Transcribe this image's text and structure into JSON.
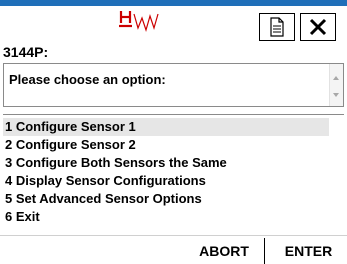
{
  "header": {
    "top_clip_text": "",
    "device_title": "3144P:"
  },
  "icons": {
    "logo": "hart-logo",
    "document": "document-icon",
    "close": "close-icon"
  },
  "prompt": {
    "text": "Please choose an option:"
  },
  "options": [
    {
      "label": "1 Configure Sensor 1",
      "selected": true
    },
    {
      "label": "2 Configure Sensor 2"
    },
    {
      "label": "3 Configure Both Sensors the Same"
    },
    {
      "label": "4 Display Sensor Configurations"
    },
    {
      "label": "5 Set Advanced Sensor Options"
    },
    {
      "label": "6 Exit"
    }
  ],
  "footer": {
    "abort_label": "ABORT",
    "enter_label": "ENTER"
  },
  "colors": {
    "accent_bar": "#1f6fb9",
    "logo_red": "#cc0000",
    "selected_row": "#e6e6e6"
  }
}
